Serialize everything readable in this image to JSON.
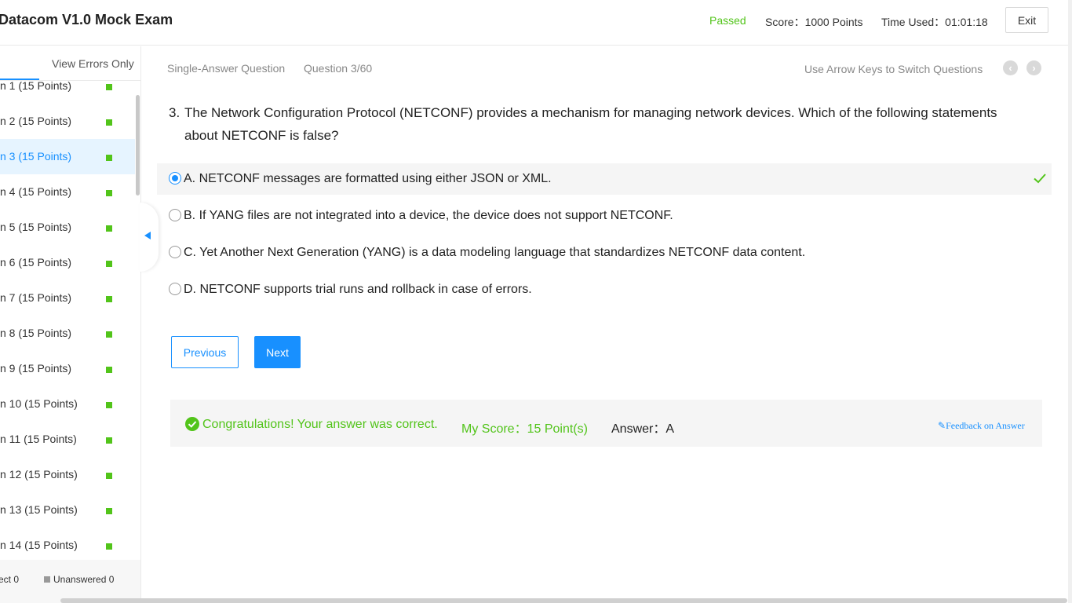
{
  "header": {
    "title": "Datacom V1.0 Mock Exam",
    "status": "Passed",
    "score": "Score：1000 Points",
    "time_used": "Time Used：01:01:18",
    "exit_label": "Exit"
  },
  "sidebar": {
    "view_errors_label": "View Errors Only",
    "items": [
      {
        "label": "n 1   (15 Points)"
      },
      {
        "label": "n 2   (15 Points)"
      },
      {
        "label": "n 3   (15 Points)"
      },
      {
        "label": "n 4   (15 Points)"
      },
      {
        "label": "n 5   (15 Points)"
      },
      {
        "label": "n 6   (15 Points)"
      },
      {
        "label": "n 7   (15 Points)"
      },
      {
        "label": "n 8   (15 Points)"
      },
      {
        "label": "n 9   (15 Points)"
      },
      {
        "label": "n 10   (15 Points)"
      },
      {
        "label": "n 11   (15 Points)"
      },
      {
        "label": "n 12   (15 Points)"
      },
      {
        "label": "n 13   (15 Points)"
      },
      {
        "label": "n 14   (15 Points)"
      }
    ],
    "active_index": 2,
    "legend": {
      "correct": "ect 0",
      "unanswered": "Unanswered 0"
    }
  },
  "question": {
    "type": "Single-Answer Question",
    "counter": "Question 3/60",
    "arrow_hint": "Use Arrow Keys to Switch Questions",
    "number": "3.",
    "text": "The Network Configuration Protocol (NETCONF) provides a mechanism for managing network devices. Which of the following statements about NETCONF is false?",
    "options": [
      {
        "text": "A. NETCONF messages are formatted using either JSON or XML."
      },
      {
        "text": "B. If YANG files are not integrated into a device, the device does not support NETCONF."
      },
      {
        "text": "C. Yet Another Next Generation (YANG) is a data modeling language that standardizes NETCONF data content."
      },
      {
        "text": "D. NETCONF supports trial runs and rollback in case of errors."
      }
    ],
    "selected_index": 0
  },
  "buttons": {
    "previous": "Previous",
    "next": "Next"
  },
  "result": {
    "message": "Congratulations! Your answer was correct.",
    "my_score": "My Score：15 Point(s)",
    "answer": "Answer：A",
    "feedback": "Feedback on Answer"
  },
  "colors": {
    "accent": "#1890ff",
    "success": "#52c41a"
  },
  "icons": {
    "check": "check-icon",
    "success": "check-circle-icon",
    "feedback": "edit-icon",
    "prev": "chevron-left-icon",
    "next": "chevron-right-icon",
    "collapse": "caret-left-icon"
  }
}
